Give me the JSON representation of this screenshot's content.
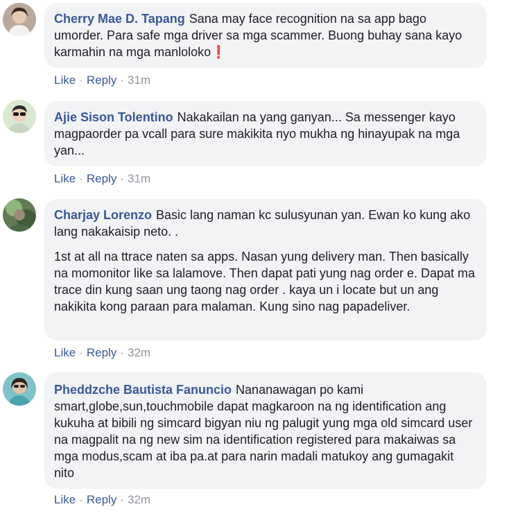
{
  "comments": [
    {
      "author": "Cherry Mae D. Tapang",
      "text": "Sana may face recognition na sa app bago umorder. Para safe mga driver sa mga scammer. Buong buhay sana kayo karmahin na mga manloloko",
      "emoji": "❗",
      "like_label": "Like",
      "reply_label": "Reply",
      "time": "31m"
    },
    {
      "author": "Ajie Sison Tolentino",
      "text": "Nakakailan na yang ganyan... Sa messenger kayo magpaorder pa vcall para sure makikita nyo mukha ng hinayupak na mga yan...",
      "like_label": "Like",
      "reply_label": "Reply",
      "time": "31m"
    },
    {
      "author": "Charjay Lorenzo",
      "text": "Basic lang naman kc sulusyunan yan. Ewan ko kung ako lang nakakaisip neto. .",
      "text2": "1st at all na ttrace naten sa apps. Nasan yung delivery man. Then basically na momonitor like sa lalamove. Then dapat pati yung nag order e. Dapat ma trace din kung saan ung taong nag order . kaya un i locate but un ang nakikita kong paraan para malaman. Kung sino nag papadeliver.",
      "like_label": "Like",
      "reply_label": "Reply",
      "time": "32m"
    },
    {
      "author": "Pheddzche Bautista Fanuncio",
      "text": "Nananawagan po kami smart,globe,sun,touchmobile dapat magkaroon na ng identification ang kukuha at bibili ng simcard bigyan niu ng palugit yung mga old simcard user na magpalit na ng new sim na identification registered para makaiwas sa mga modus,scam at iba pa.at para narin madali matukoy ang gumagakit nito",
      "like_label": "Like",
      "reply_label": "Reply",
      "time": "32m"
    }
  ],
  "colors": {
    "author": "#385898",
    "bubble_bg": "#f2f3f5",
    "text": "#1c1e21",
    "muted": "#90949c"
  },
  "avatars": [
    "avatar-woman-photo",
    "avatar-man-sunglasses-photo",
    "avatar-green-photo",
    "avatar-woman-teal-photo"
  ]
}
